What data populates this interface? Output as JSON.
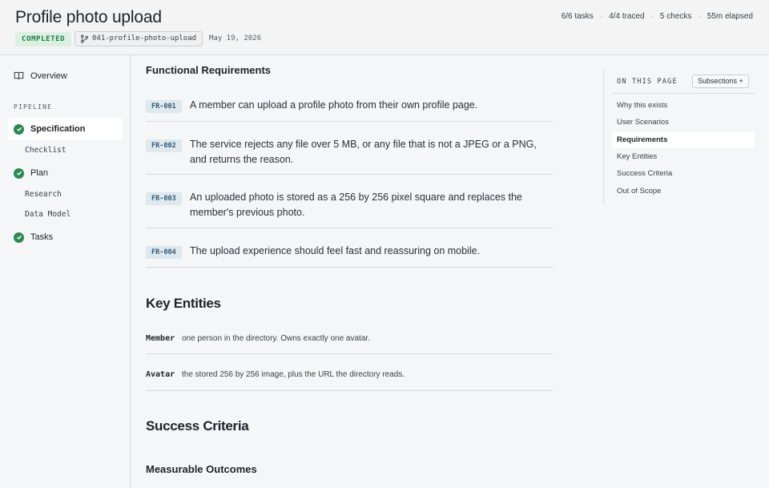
{
  "header": {
    "title": "Profile photo upload",
    "status": "COMPLETED",
    "branch": "041-profile-photo-upload",
    "date": "May 19, 2026",
    "stats": [
      "6/6 tasks",
      "4/4 traced",
      "5 checks",
      "55m elapsed"
    ],
    "separator": "·"
  },
  "sidebar": {
    "overview": "Overview",
    "pipeline_label": "PIPELINE",
    "steps": [
      {
        "label": "Specification",
        "active": true
      },
      {
        "label": "Checklist",
        "sub": true
      },
      {
        "label": "Plan"
      },
      {
        "label": "Research",
        "sub": true
      },
      {
        "label": "Data Model",
        "sub": true
      },
      {
        "label": "Tasks"
      }
    ]
  },
  "main": {
    "functional_title": "Functional Requirements",
    "requirements": [
      {
        "id": "FR-001",
        "text": "A member can upload a profile photo from their own profile page."
      },
      {
        "id": "FR-002",
        "text": "The service rejects any file over 5 MB, or any file that is not a JPEG or a PNG, and returns the reason."
      },
      {
        "id": "FR-003",
        "text": "An uploaded photo is stored as a 256 by 256 pixel square and replaces the member's previous photo."
      },
      {
        "id": "FR-004",
        "text": "The upload experience should feel fast and reassuring on mobile."
      }
    ],
    "key_entities_title": "Key Entities",
    "entities": [
      {
        "name": "Member",
        "desc": "one person in the directory. Owns exactly one avatar."
      },
      {
        "name": "Avatar",
        "desc": "the stored 256 by 256 image, plus the URL the directory reads."
      }
    ],
    "success_title": "Success Criteria",
    "measurable_title": "Measurable Outcomes"
  },
  "toc": {
    "heading": "ON THIS PAGE",
    "subsections_btn": "Subsections +",
    "items": [
      {
        "label": "Why this exists"
      },
      {
        "label": "User Scenarios"
      },
      {
        "label": "Requirements",
        "active": true
      },
      {
        "label": "Key Entities"
      },
      {
        "label": "Success Criteria"
      },
      {
        "label": "Out of Scope"
      }
    ]
  },
  "colors": {
    "status_bg": "#dcefe3",
    "status_fg": "#1f7a43",
    "check": "#2a8a4f",
    "tag_bg": "#dde8ef",
    "tag_fg": "#355a75"
  }
}
